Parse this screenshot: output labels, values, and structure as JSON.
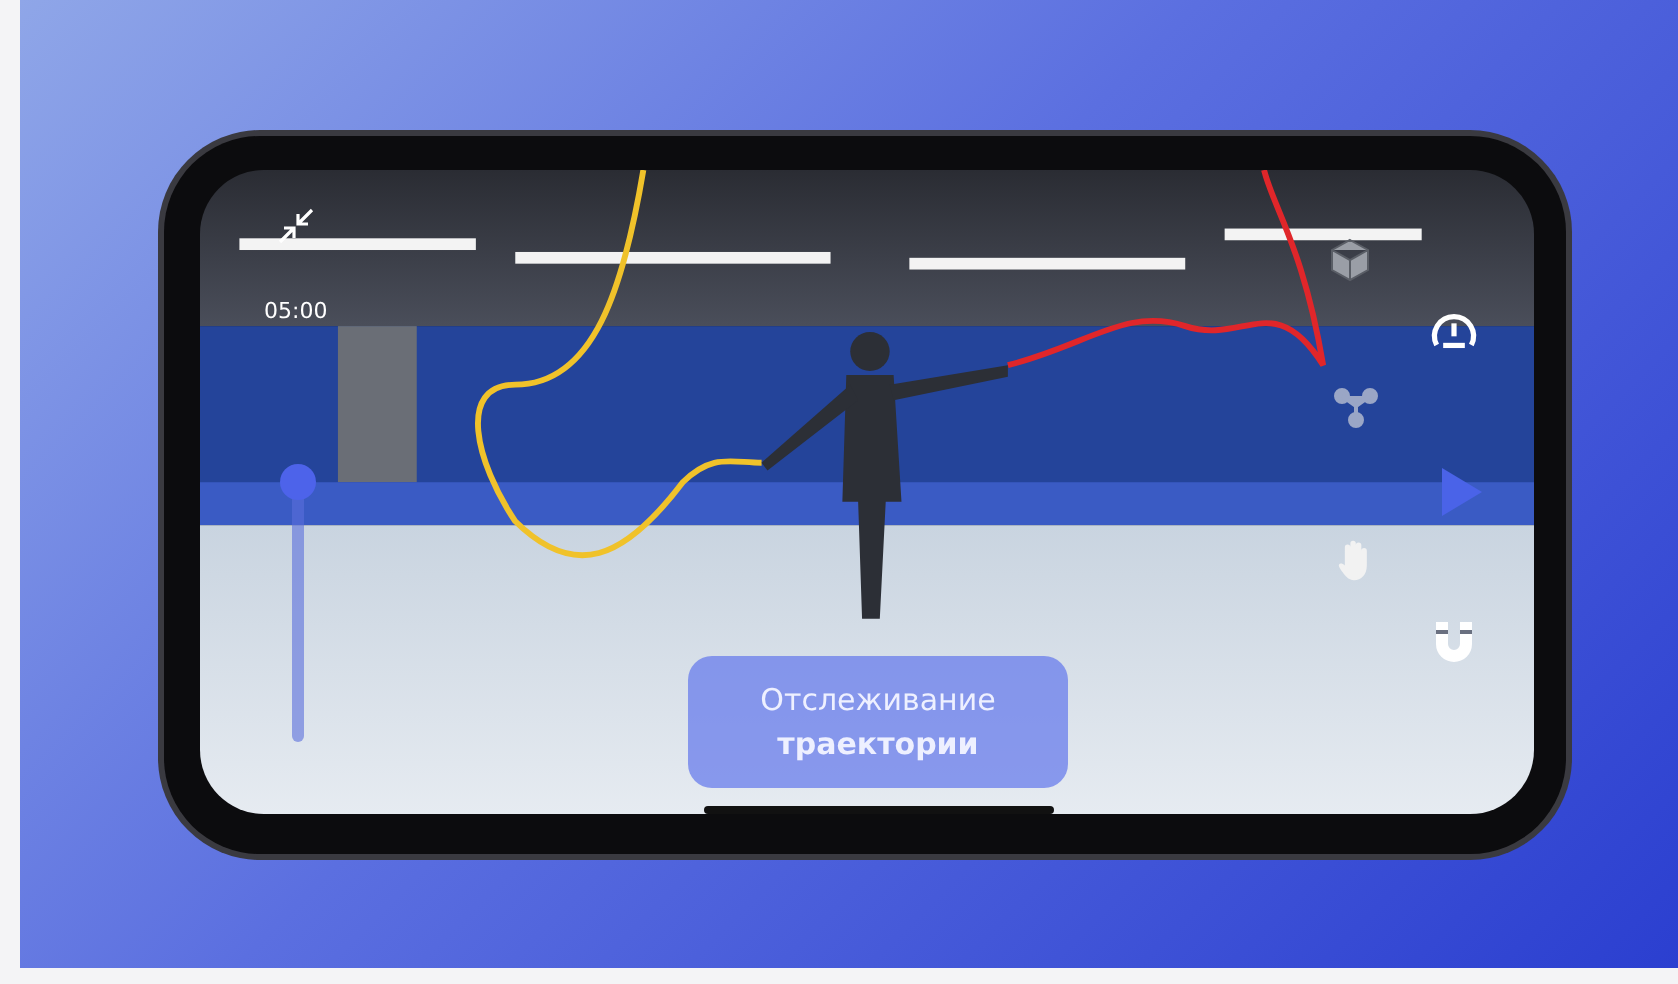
{
  "timer": "05:00",
  "timeline_slider": {
    "level": 1
  },
  "caption": "Отслеживание **траектории**"
}
